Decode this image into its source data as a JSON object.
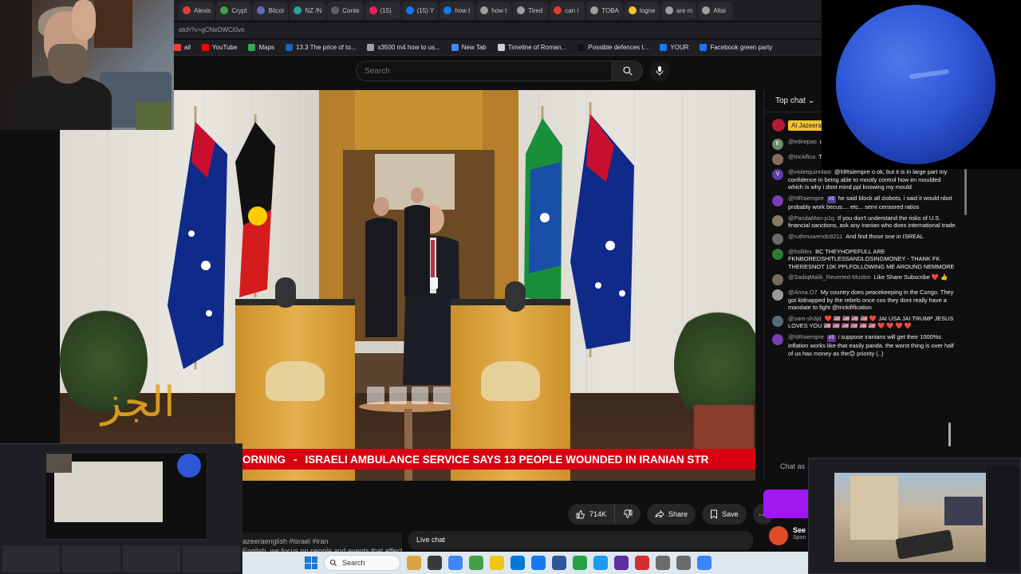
{
  "browser": {
    "tabs": [
      "Alexis",
      "Crypt",
      "Bitcoi",
      "NZ /N",
      "Conte",
      "(15)",
      "(15) Y",
      "how t",
      "how t",
      "Tired",
      "can i",
      "TOBA",
      "logne",
      "are m",
      "Altai"
    ],
    "tab_colors": [
      "#e53935",
      "#43a047",
      "#5c6bc0",
      "#26a69a",
      "#616161",
      "#e91e63",
      "#1877f2",
      "#1877f2",
      "#9e9e9e",
      "#9e9e9e",
      "#e53935",
      "#9e9e9e",
      "#fbc02d",
      "#9e9e9e",
      "#9e9e9e"
    ],
    "url_fragment": "atch?v=gCNeDWCl0vo",
    "bookmarks": [
      {
        "label": "ail",
        "color": "#ea4335"
      },
      {
        "label": "YouTube",
        "color": "#ff0000"
      },
      {
        "label": "Maps",
        "color": "#34a853"
      },
      {
        "label": "13.3 The price of to...",
        "color": "#1565c0"
      },
      {
        "label": "x3500 m4 how to us...",
        "color": "#9e9e9e"
      },
      {
        "label": "New Tab",
        "color": "#4285f4"
      },
      {
        "label": "Timeline of Roman...",
        "color": "#cfcfcf"
      },
      {
        "label": "Possible defences t...",
        "color": "#111111"
      },
      {
        "label": "YOUR",
        "color": "#1877f2"
      },
      {
        "label": "Facebook green party",
        "color": "#1877f2"
      }
    ]
  },
  "youtube": {
    "search_placeholder": "Search",
    "ticker_prefix": "ORNING",
    "ticker_text": "ISRAELI AMBULANCE SERVICE SAYS 13 PEOPLE WOUNDED IN IRANIAN STR",
    "like_count": "714K",
    "share_label": "Share",
    "save_label": "Save",
    "desc_line1": "azeeraenglish #israel #iran",
    "desc_line2": "English, we focus on people and events that affect",
    "live_chat_label": "Live chat",
    "promo_title": "See",
    "promo_sub": "Spon"
  },
  "chat": {
    "header": "Top chat",
    "pinned": "Al Jazeera",
    "chat_as": "Chat as",
    "messages": [
      {
        "author": "@edriepas",
        "text": "down?",
        "avatar": "E",
        "color": "#6b8e6b"
      },
      {
        "author": "@trickifica",
        "text": "The Peacekeepers do. How fcking dare you.",
        "avatar": "",
        "color": "#8a6a5a"
      },
      {
        "author": "@violetquinnlaw",
        "text": "@hlRsiempre o ok, but it is in large part my confidence in being able to mostly control how im moulded which is why i dont mind ppl knowing my mould",
        "avatar": "V",
        "color": "#5c3ea8"
      },
      {
        "author": "@hlRsiempre",
        "badge": "#3",
        "text": "he said block all ziobots, i said it would nbot probably work becus.... etc... semi censored ratios",
        "avatar": "",
        "color": "#7a3fb0"
      },
      {
        "author": "@PandaMan-p1q",
        "text": "If you don't understand the risks of U.S. financial sanctions, ask any Iranian who does international trade.",
        "avatar": "",
        "color": "#8a7a6a"
      },
      {
        "author": "@ruthmuwendo9211",
        "text": "And find those one in ISREAL",
        "avatar": "",
        "color": "#6a6a6a"
      },
      {
        "author": "@hollilex",
        "text": "BC THEYHOPEFULL ARE FKNBOREDSHITLESSANDLOSINGMONEY - THANK FK THERESNOT 10K PPLFOLLOWING ME AROUND NEMMORE",
        "avatar": "",
        "color": "#2e7d32"
      },
      {
        "author": "@SadiqMalik_Reverted-Muslim",
        "text": "Like Share Subscribe ❤️ 👍",
        "avatar": "",
        "color": "#7a6a5a"
      },
      {
        "author": "@Anna.O7",
        "text": "My country does peacekeeping in the Congo. They got kidnapped by the rebels once cos they dont really have a mandate to fight @trickifification",
        "avatar": "",
        "color": "#9a9a9a"
      },
      {
        "author": "@sam-sh3jd",
        "text": "❤️ 🇺🇸 🇺🇸 🇺🇸 🇺🇸 ❤️ JAI USA JAI TRUMP JESUS LOVES YOU 🇺🇸 🇺🇸 🇺🇸 🇺🇸 🇺🇸 🇺🇸 ❤️ ❤️ ❤️ ❤️",
        "avatar": "",
        "color": "#5a6a7a"
      },
      {
        "author": "@hlRsiempre",
        "badge": "#3",
        "text": "i suppose iranians will get their 1000%s inflation works like that easily panda. the worst thing is over half of us has money as the😊 priority (..)",
        "avatar": "",
        "color": "#7a3fb0"
      }
    ]
  },
  "taskbar": {
    "search_label": "Search",
    "icons": [
      "#d9a441",
      "#3a3a3a",
      "#4285f4",
      "#43a047",
      "#f0c419",
      "#0078d4",
      "#1877f2",
      "#2b579a",
      "#25a244",
      "#1d9bf0",
      "#5b2ea6",
      "#d32f2f",
      "#6b6b6b",
      "#6b6b6b",
      "#3a86ff"
    ]
  }
}
